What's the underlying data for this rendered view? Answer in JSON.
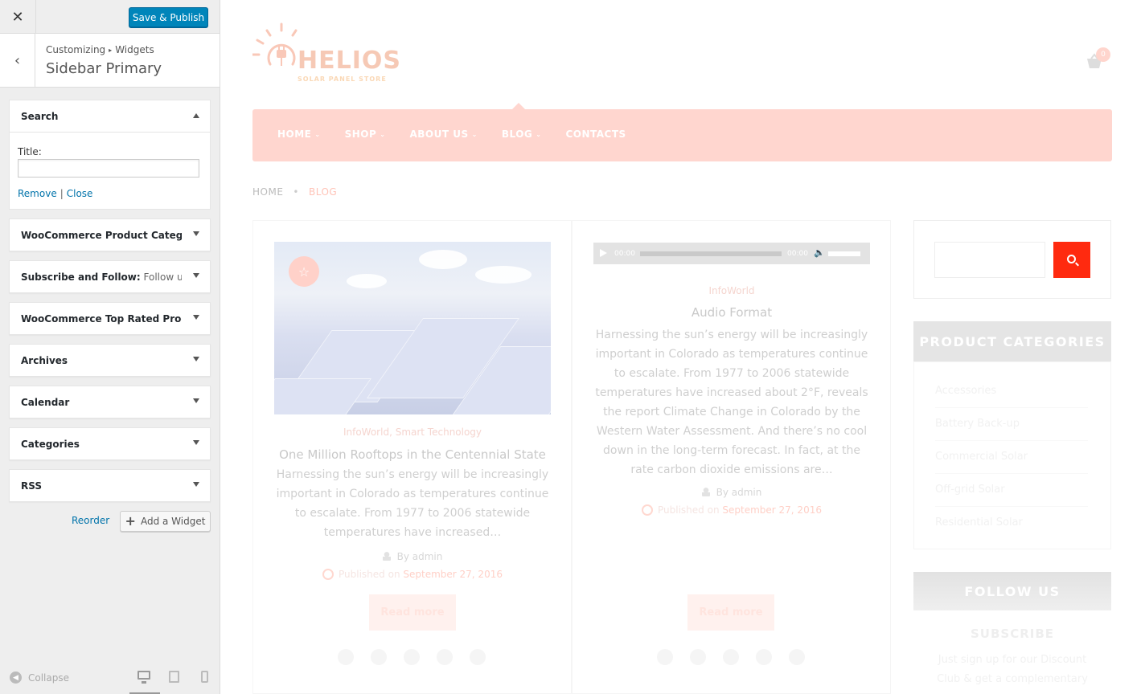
{
  "customizer": {
    "save_label": "Save & Publish",
    "close_glyph": "✕",
    "back_glyph": "‹",
    "breadcrumb": {
      "root": "Customizing",
      "sep": "▸",
      "section": "Widgets"
    },
    "panel_title": "Sidebar Primary",
    "open_widget": {
      "title": "Search",
      "field_label": "Title:",
      "field_value": "",
      "remove_label": "Remove",
      "close_label": "Close"
    },
    "widgets": [
      {
        "title": "WooCommerce Product Categor...",
        "sub": ""
      },
      {
        "title": "Subscribe and Follow:",
        "sub": " Follow us"
      },
      {
        "title": "WooCommerce Top Rated Produ...",
        "sub": ""
      },
      {
        "title": "Archives",
        "sub": ""
      },
      {
        "title": "Calendar",
        "sub": ""
      },
      {
        "title": "Categories",
        "sub": ""
      },
      {
        "title": "RSS",
        "sub": ""
      }
    ],
    "reorder_label": "Reorder",
    "add_widget_label": "Add a Widget",
    "collapse_label": "Collapse",
    "accent_color": "#0085ba"
  },
  "site": {
    "logo_text": "HELIOS",
    "logo_sub": "SOLAR PANEL STORE",
    "cart_count": "0",
    "menu": [
      "HOME",
      "SHOP",
      "ABOUT US",
      "BLOG",
      "CONTACTS"
    ],
    "breadcrumb": {
      "home": "HOME",
      "current": "BLOG"
    },
    "posts": [
      {
        "categories": "InfoWorld, Smart Technology",
        "title": "One Million Rooftops in the Centennial State",
        "excerpt": "Harnessing the sun’s energy will be increasingly important in Colorado as temperatures continue to escalate. From 1977 to 2006 statewide temperatures have increased…",
        "author": "By admin",
        "published_prefix": "Published on",
        "date": "September 27, 2016",
        "read_more": "Read more"
      },
      {
        "audio": {
          "current": "00:00",
          "duration": "00:00"
        },
        "categories": "InfoWorld",
        "title": "Audio Format",
        "excerpt": "Harnessing the sun’s energy will be increasingly important in Colorado as temperatures continue to escalate. From 1977 to 2006 statewide temperatures have increased about 2°F, reveals the report Climate Change in Colorado by the Western Water Assessment. And there’s no cool down in the long-term forecast. In fact, at the rate carbon dioxide emissions are…",
        "author": "By admin",
        "published_prefix": "Published on",
        "date": "September 27, 2016",
        "read_more": "Read more"
      }
    ],
    "sidebar": {
      "product_categories_title": "PRODUCT CATEGORIES",
      "product_categories": [
        "Accessories",
        "Battery Back-up",
        "Commercial Solar",
        "Off-grid Solar",
        "Residential Solar"
      ],
      "follow_title": "FOLLOW US",
      "subscribe_title": "SUBSCRIBE",
      "subscribe_text": "Just sign up for our Discount Club & get a complementary"
    },
    "brand_color": "#ff2a0f"
  }
}
